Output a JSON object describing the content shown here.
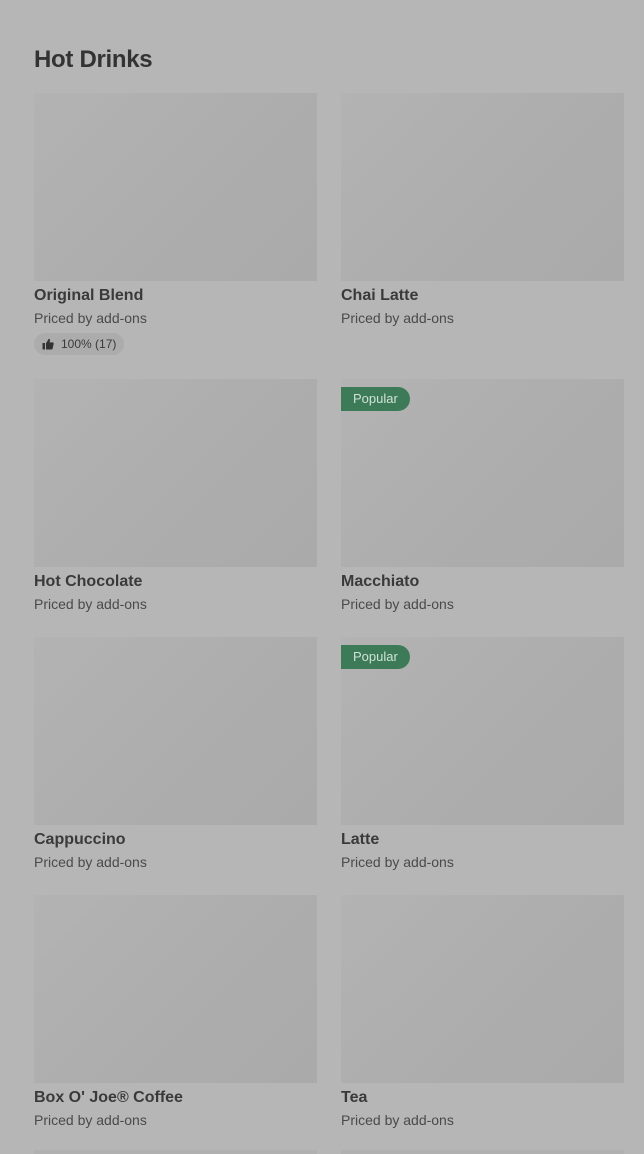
{
  "section": {
    "title": "Hot Drinks"
  },
  "items": [
    {
      "name": "Original Blend",
      "price": "Priced by add-ons",
      "badge": "",
      "rating": "100% (17)"
    },
    {
      "name": "Chai Latte",
      "price": "Priced by add-ons",
      "badge": "",
      "rating": ""
    },
    {
      "name": "Hot Chocolate",
      "price": "Priced by add-ons",
      "badge": "",
      "rating": ""
    },
    {
      "name": "Macchiato",
      "price": "Priced by add-ons",
      "badge": "Popular",
      "rating": ""
    },
    {
      "name": "Cappuccino",
      "price": "Priced by add-ons",
      "badge": "",
      "rating": ""
    },
    {
      "name": "Latte",
      "price": "Priced by add-ons",
      "badge": "Popular",
      "rating": ""
    },
    {
      "name": "Box O' Joe® Coffee",
      "price": "Priced by add-ons",
      "badge": "",
      "rating": ""
    },
    {
      "name": "Tea",
      "price": "Priced by add-ons",
      "badge": "",
      "rating": ""
    }
  ],
  "colors": {
    "background": "#b6b6b6",
    "badge": "#3d7a57",
    "text": "#333333"
  },
  "icons": {
    "rating": "thumbs-up-icon"
  }
}
